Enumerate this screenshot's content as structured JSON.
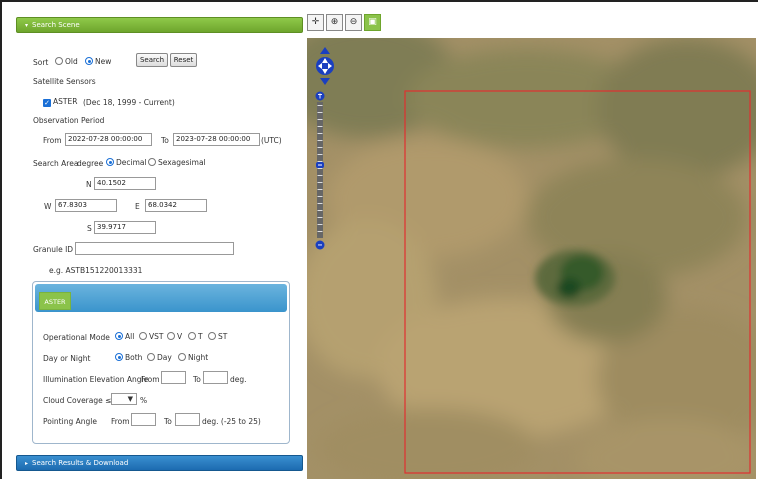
{
  "search_scene": {
    "header": "Search Scene",
    "sort": {
      "label": "Sort",
      "old_label": "Old",
      "new_label": "New",
      "selected": "New"
    },
    "search_button": "Search",
    "reset_button": "Reset",
    "satellite_sensors": {
      "label": "Satellite Sensors",
      "aster_label": "ASTER",
      "aster_range": "(Dec 18, 1999 - Current)",
      "aster_checked": true
    },
    "observation_period": {
      "label": "Observation Period",
      "from_label": "From",
      "from_value": "2022-07-28 00:00:00",
      "to_label": "To",
      "to_value": "2023-07-28 00:00:00",
      "tz": "(UTC)"
    },
    "search_area": {
      "label": "Search Area",
      "unit_label": "degree",
      "decimal_label": "Decimal",
      "sexagesimal_label": "Sexagesimal",
      "selected": "Decimal",
      "n_label": "N",
      "n_value": "40.1502",
      "w_label": "W",
      "w_value": "67.8303",
      "e_label": "E",
      "e_value": "68.0342",
      "s_label": "S",
      "s_value": "39.9717"
    },
    "granule": {
      "label": "Granule ID",
      "value": "",
      "example": "e.g. ASTB151220013331"
    },
    "aster": {
      "tab_label": "ASTER",
      "operational_mode": {
        "label": "Operational Mode",
        "options": [
          "All",
          "VST",
          "V",
          "T",
          "ST"
        ],
        "selected": "All"
      },
      "day_or_night": {
        "label": "Day or Night",
        "options": [
          "Both",
          "Day",
          "Night"
        ],
        "selected": "Both"
      },
      "illumination": {
        "label": "Illumination Elevation Angle",
        "from_label": "From",
        "to_label": "To",
        "unit": "deg.",
        "from_value": "",
        "to_value": ""
      },
      "cloud_coverage": {
        "label": "Cloud Coverage ≤",
        "value": "",
        "unit": "%"
      },
      "pointing_angle": {
        "label": "Pointing Angle",
        "from_label": "From",
        "to_label": "To",
        "unit": "deg. (-25 to 25)",
        "from_value": "",
        "to_value": ""
      }
    }
  },
  "results_header": "Search Results & Download",
  "map": {
    "toolbar": [
      {
        "name": "pan-tool",
        "icon": "✛"
      },
      {
        "name": "zoom-in-tool",
        "icon": "⊕"
      },
      {
        "name": "zoom-out-tool",
        "icon": "⊖"
      },
      {
        "name": "select-tool",
        "icon": "▣"
      }
    ],
    "colors": {
      "terrain_base": "#9c8d5f",
      "vegetation": "#2d5a25",
      "selection_box": "#e03030",
      "nav_blue": "#1a3fc0",
      "accent_green": "#6ea52c"
    }
  }
}
